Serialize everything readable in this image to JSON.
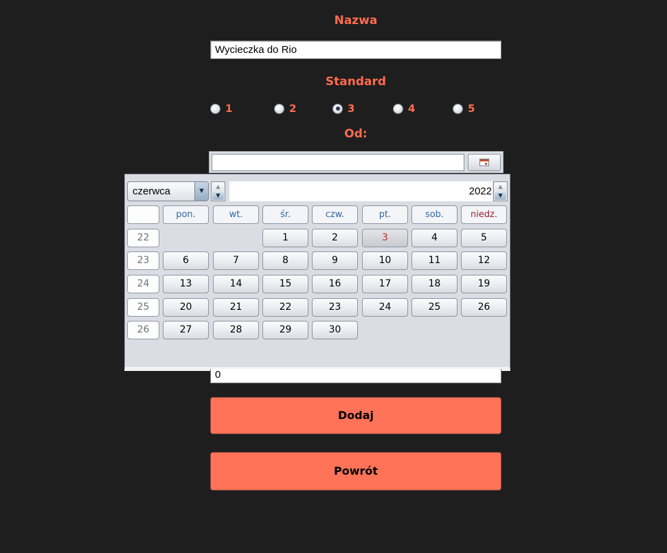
{
  "form": {
    "name_label": "Nazwa",
    "name_value": "Wycieczka do Rio",
    "standard_label": "Standard",
    "standard_options": [
      "1",
      "2",
      "3",
      "4",
      "5"
    ],
    "standard_selected": "3",
    "from_label": "Od:",
    "from_value": "",
    "number_value": "0",
    "add_button": "Dodaj",
    "back_button": "Powrót"
  },
  "calendar": {
    "month": "czerwca",
    "year": "2022",
    "week_header": "",
    "weekdays": [
      "pon.",
      "wt.",
      "śr.",
      "czw.",
      "pt.",
      "sob.",
      "niedz."
    ],
    "weeks": [
      {
        "week": "22",
        "days": [
          "",
          "",
          "1",
          "2",
          "3",
          "4",
          "5"
        ]
      },
      {
        "week": "23",
        "days": [
          "6",
          "7",
          "8",
          "9",
          "10",
          "11",
          "12"
        ]
      },
      {
        "week": "24",
        "days": [
          "13",
          "14",
          "15",
          "16",
          "17",
          "18",
          "19"
        ]
      },
      {
        "week": "25",
        "days": [
          "20",
          "21",
          "22",
          "23",
          "24",
          "25",
          "26"
        ]
      },
      {
        "week": "26",
        "days": [
          "27",
          "28",
          "29",
          "30",
          "",
          "",
          ""
        ]
      }
    ],
    "today": "3",
    "today_color": "#c32f2f",
    "weekday_color": "#2f67a3",
    "sunday_color": "#a01f2b"
  },
  "colors": {
    "background": "#1e1e1e",
    "accent": "#ff6b4f",
    "button": "#ff7358"
  },
  "icons": {
    "calendar": "calendar-icon",
    "dropdown": "chevron-down-icon",
    "spinner_up": "triangle-up-icon",
    "spinner_down": "triangle-down-icon"
  }
}
